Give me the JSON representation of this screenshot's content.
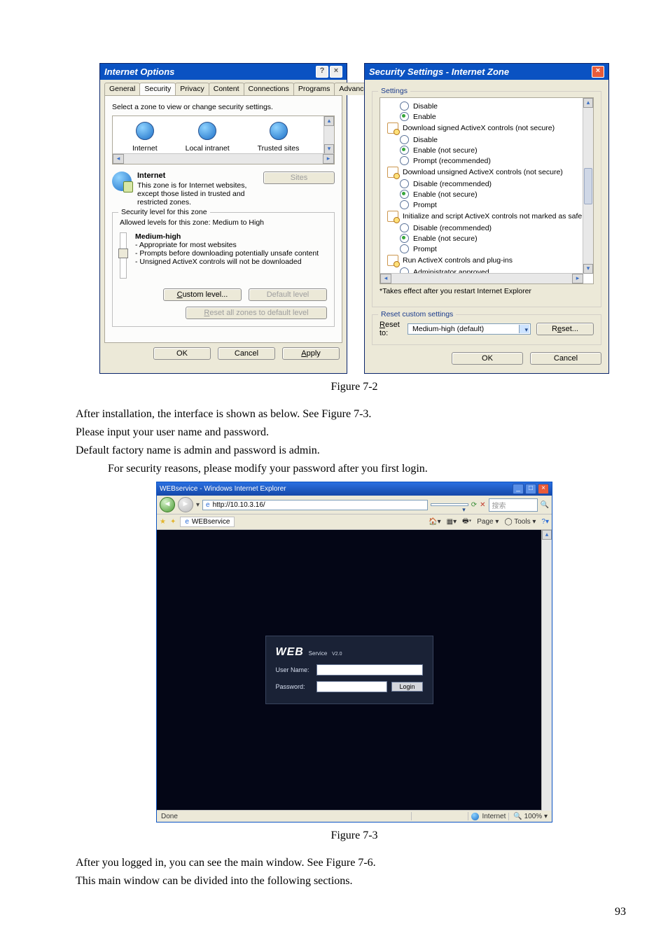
{
  "page_number": "93",
  "figure1_caption": "Figure 7-2",
  "figure2_caption": "Figure 7-3",
  "body_text": {
    "p1": "After installation, the interface is shown as below. See Figure 7-3.",
    "p2": "Please input your user name and password.",
    "p3": "Default factory name is admin and password is admin.",
    "p4": "For security reasons, please modify your password after you first login."
  },
  "body_text2": {
    "p1": "After you logged in, you can see the main window.  See Figure 7-6.",
    "p2": "This main window can be divided into the following sections."
  },
  "internet_options": {
    "title": "Internet Options",
    "help_icon": "?",
    "close_icon": "×",
    "tabs": [
      "General",
      "Security",
      "Privacy",
      "Content",
      "Connections",
      "Programs",
      "Advanced"
    ],
    "selected_tab": "Security",
    "prompt": "Select a zone to view or change security settings.",
    "zones": [
      "Internet",
      "Local intranet",
      "Trusted sites"
    ],
    "zone_selected": {
      "name": "Internet",
      "desc": "This zone is for Internet websites, except those listed in trusted and restricted zones."
    },
    "sites_button": "Sites",
    "security_level_legend": "Security level for this zone",
    "allowed_label": "Allowed levels for this zone: Medium to High",
    "level_name": "Medium-high",
    "level_bullets": [
      "- Appropriate for most websites",
      "- Prompts before downloading potentially unsafe content",
      "- Unsigned ActiveX controls will not be downloaded"
    ],
    "custom_level": "Custom level...",
    "default_level": "Default level",
    "reset_all": "Reset all zones to default level",
    "ok": "OK",
    "cancel": "Cancel",
    "apply": "Apply"
  },
  "security_settings": {
    "title": "Security Settings - Internet Zone",
    "close_icon": "×",
    "settings_legend": "Settings",
    "items": [
      {
        "type": "radio",
        "label": "Disable",
        "selected": false,
        "indent": 1
      },
      {
        "type": "radio",
        "label": "Enable",
        "selected": true,
        "indent": 1
      },
      {
        "type": "header",
        "label": "Download signed ActiveX controls (not secure)"
      },
      {
        "type": "radio",
        "label": "Disable",
        "selected": false,
        "indent": 1
      },
      {
        "type": "radio",
        "label": "Enable (not secure)",
        "selected": true,
        "indent": 1
      },
      {
        "type": "radio",
        "label": "Prompt (recommended)",
        "selected": false,
        "indent": 1
      },
      {
        "type": "header",
        "label": "Download unsigned ActiveX controls (not secure)"
      },
      {
        "type": "radio",
        "label": "Disable (recommended)",
        "selected": false,
        "indent": 1
      },
      {
        "type": "radio",
        "label": "Enable (not secure)",
        "selected": true,
        "indent": 1
      },
      {
        "type": "radio",
        "label": "Prompt",
        "selected": false,
        "indent": 1
      },
      {
        "type": "header",
        "label": "Initialize and script ActiveX controls not marked as safe for sc"
      },
      {
        "type": "radio",
        "label": "Disable (recommended)",
        "selected": false,
        "indent": 1
      },
      {
        "type": "radio",
        "label": "Enable (not secure)",
        "selected": true,
        "indent": 1
      },
      {
        "type": "radio",
        "label": "Prompt",
        "selected": false,
        "indent": 1
      },
      {
        "type": "header",
        "label": "Run ActiveX controls and plug-ins"
      },
      {
        "type": "radio",
        "label": "Administrator approved",
        "selected": false,
        "indent": 1
      }
    ],
    "note": "*Takes effect after you restart Internet Explorer",
    "reset_legend": "Reset custom settings",
    "reset_to_label": "Reset to:",
    "reset_to_value": "Medium-high (default)",
    "reset_button": "Reset...",
    "ok": "OK",
    "cancel": "Cancel"
  },
  "ie_window": {
    "title": "WEBservice - Windows Internet Explorer",
    "url": "http://10.10.3.16/",
    "search_placeholder": "搜索",
    "tab_label": "WEBservice",
    "tools": {
      "page": "Page",
      "tools": "Tools"
    },
    "login": {
      "brand": "WEB",
      "brand_sub": "Service",
      "brand_ver": "V2.0",
      "user_label": "User Name:",
      "password_label": "Password:",
      "login_button": "Login"
    },
    "status_left": "Done",
    "status_zone": "Internet",
    "zoom": "100%"
  }
}
